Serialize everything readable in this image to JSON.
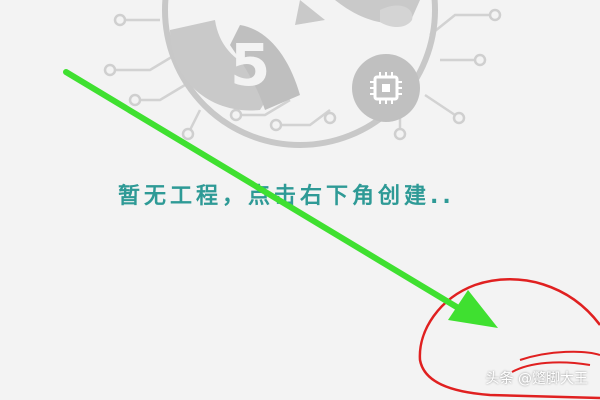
{
  "empty_state": {
    "message": "暂无工程，点击右下角创建..",
    "illustration": "chip-circuit-illustration"
  },
  "annotations": {
    "arrow_color": "#3fe030",
    "circle_color": "#e02020"
  },
  "watermark": {
    "text": "头条 @蹩脚大王"
  },
  "colors": {
    "background": "#f3f3f3",
    "illustration": "#c9c9c9",
    "message": "#2e9a96"
  }
}
